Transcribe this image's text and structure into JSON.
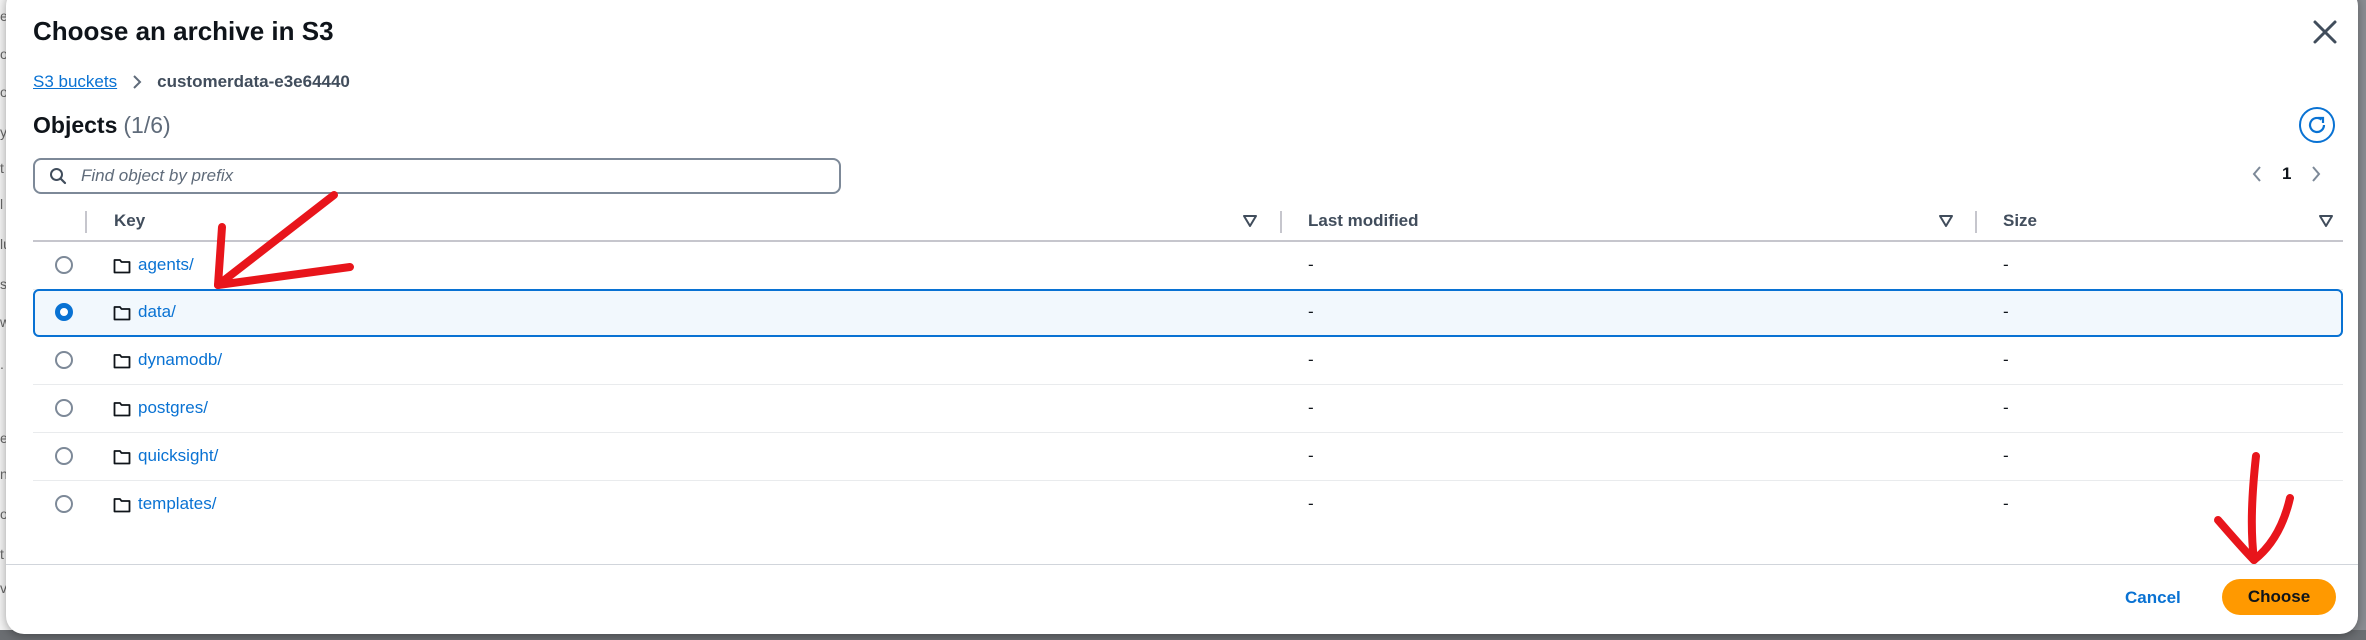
{
  "modal": {
    "title": "Choose an archive in S3",
    "breadcrumb": {
      "root_label": "S3 buckets",
      "current": "customerdata-e3e64440"
    },
    "objects": {
      "heading": "Objects",
      "count": "(1/6)"
    },
    "search": {
      "placeholder": "Find object by prefix",
      "value": ""
    },
    "pagination": {
      "current_page": "1"
    },
    "table": {
      "columns": [
        "Key",
        "Last modified",
        "Size"
      ],
      "rows": [
        {
          "key": "agents/",
          "last_modified": "-",
          "size": "-",
          "selected": false
        },
        {
          "key": "data/",
          "last_modified": "-",
          "size": "-",
          "selected": true
        },
        {
          "key": "dynamodb/",
          "last_modified": "-",
          "size": "-",
          "selected": false
        },
        {
          "key": "postgres/",
          "last_modified": "-",
          "size": "-",
          "selected": false
        },
        {
          "key": "quicksight/",
          "last_modified": "-",
          "size": "-",
          "selected": false
        },
        {
          "key": "templates/",
          "last_modified": "-",
          "size": "-",
          "selected": false
        }
      ]
    },
    "footer": {
      "cancel_label": "Cancel",
      "choose_label": "Choose"
    }
  },
  "icons": {
    "close": "close-icon",
    "breadcrumb_separator": "chevron-right-icon",
    "refresh": "refresh-icon",
    "search": "search-icon",
    "prev_page": "chevron-left-icon",
    "next_page": "chevron-right-icon",
    "sort": "sort-caret-icon",
    "folder": "folder-icon"
  },
  "colors": {
    "accent": "#0972d3",
    "primary_button": "#ff9900",
    "selected_row_bg": "#f2f8fd",
    "annotation": "#e8151b"
  }
}
